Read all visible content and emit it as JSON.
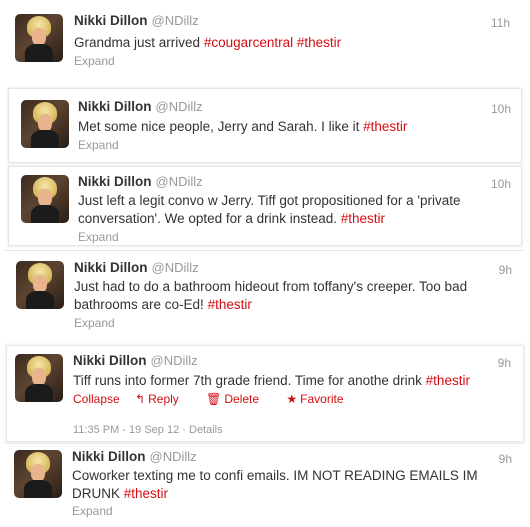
{
  "author": {
    "name": "Nikki Dillon",
    "handle": "@NDillz"
  },
  "tweets": [
    {
      "time": "11h",
      "text": "Grandma just arrived ",
      "tags": "#cougarcentral #thestir",
      "expand": "Expand"
    },
    {
      "time": "10h",
      "text": "Met some nice people, Jerry and Sarah. I like it ",
      "tags": "#thestir",
      "expand": "Expand"
    },
    {
      "time": "10h",
      "text": "Just left a legit convo w Jerry. Tiff got propositioned for a 'private conversation'. We opted for a drink instead. ",
      "tags": "#thestir",
      "expand": "Expand"
    },
    {
      "time": "9h",
      "text": "Just had to do a bathroom hideout from toffany's creeper. Too bad bathrooms are co-Ed! ",
      "tags": "#thestir",
      "expand": "Expand"
    },
    {
      "time": "9h",
      "text": "Tiff runs into former 7th grade friend. Time for anothe drink ",
      "tags": "#thestir",
      "expand": "Collapse",
      "actions": {
        "reply": "Reply",
        "delete": "Delete",
        "favorite": "Favorite"
      },
      "timestamp": "11:35 PM - 19 Sep 12",
      "details": "Details"
    },
    {
      "time": "9h",
      "text": "Coworker texting me to confi emails. IM NOT READING EMAILS IM DRUNK ",
      "tags": "#thestir",
      "expand": "Expand"
    }
  ],
  "colors": {
    "accent": "#d40d12",
    "muted": "#999999",
    "text": "#333333"
  }
}
